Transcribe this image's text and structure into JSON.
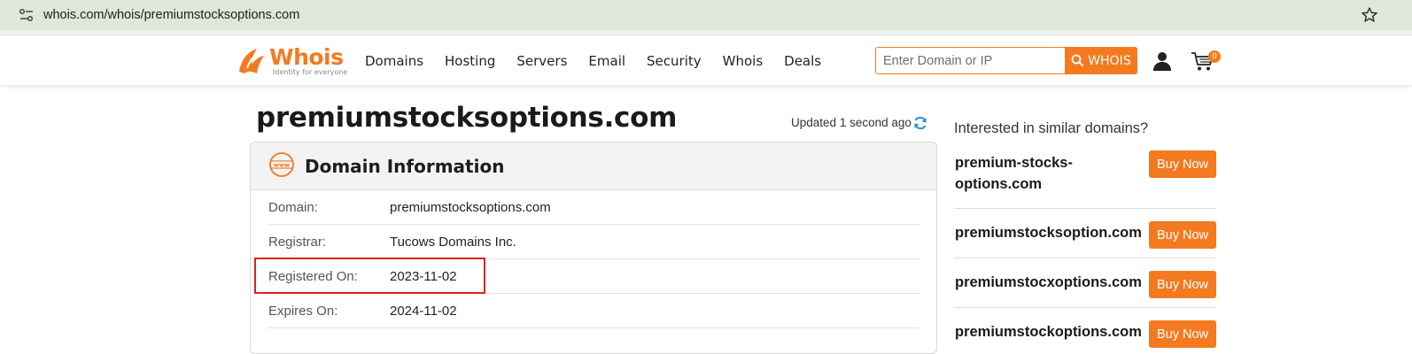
{
  "browser": {
    "url": "whois.com/whois/premiumstocksoptions.com"
  },
  "header": {
    "logo_text": "Whois",
    "logo_tagline": "Identity for everyone",
    "nav": [
      "Domains",
      "Hosting",
      "Servers",
      "Email",
      "Security",
      "Whois",
      "Deals"
    ],
    "search_placeholder": "Enter Domain or IP",
    "search_button": "WHOIS",
    "cart_count": "0"
  },
  "main": {
    "domain_title": "premiumstocksoptions.com",
    "updated_prefix": "Updated",
    "updated_time": "1 second ago",
    "card_title": "Domain Information",
    "rows": [
      {
        "label": "Domain:",
        "value": "premiumstocksoptions.com"
      },
      {
        "label": "Registrar:",
        "value": "Tucows Domains Inc."
      },
      {
        "label": "Registered On:",
        "value": "2023-11-02"
      },
      {
        "label": "Expires On:",
        "value": "2024-11-02"
      }
    ]
  },
  "sidebar": {
    "title": "Interested in similar domains?",
    "items": [
      {
        "name_line1": "premium-stocks-",
        "name_line2": "options.com",
        "button": "Buy Now"
      },
      {
        "name": "premiumstocksoption.com",
        "button": "Buy Now"
      },
      {
        "name": "premiumstocxoptions.com",
        "button": "Buy Now"
      },
      {
        "name": "premiumstockoptions.com",
        "button": "Buy Now"
      }
    ]
  },
  "colors": {
    "brand_orange": "#f47a20",
    "annotation_red": "#e02020"
  },
  "icons": [
    "site-settings-icon",
    "bookmark-star-icon",
    "search-icon",
    "user-icon",
    "cart-icon",
    "refresh-icon",
    "www-icon"
  ]
}
